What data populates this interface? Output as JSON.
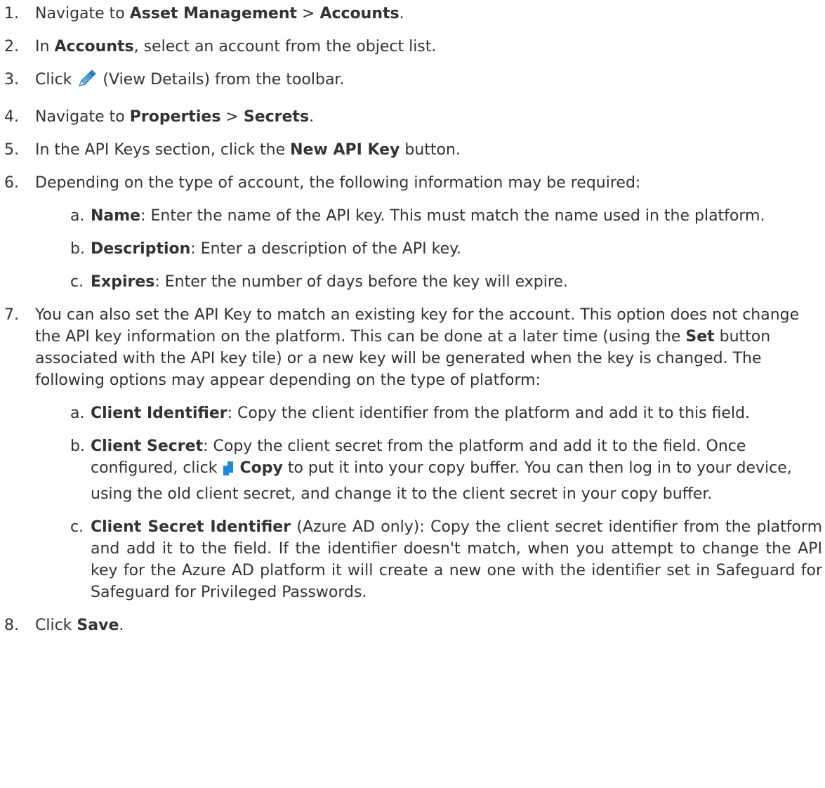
{
  "steps": [
    {
      "num": "1.",
      "t1": "Navigate to ",
      "b1": "Asset Management",
      "t2": " > ",
      "b2": "Accounts",
      "t3": "."
    },
    {
      "num": "2.",
      "t1": "In ",
      "b1": "Accounts",
      "t2": ", select an account from the object list."
    },
    {
      "num": "3.",
      "t1": "Click ",
      "icon": "pencil-icon",
      "t2": " (View Details) from the toolbar."
    },
    {
      "num": "4.",
      "t1": "Navigate to ",
      "b1": "Properties",
      "t2": " > ",
      "b2": "Secrets",
      "t3": "."
    },
    {
      "num": "5.",
      "t1": "In the API Keys section, click the ",
      "b1": "New API Key",
      "t2": " button."
    },
    {
      "num": "6.",
      "t1": "Depending on the type of account, the following information may be required:",
      "subs": [
        {
          "num": "a.",
          "b1": "Name",
          "t1": ": Enter the name of the API key. This must match the name used in the platform."
        },
        {
          "num": "b.",
          "b1": "Description",
          "t1": ": Enter a description of the API key."
        },
        {
          "num": "c.",
          "b1": "Expires",
          "t1": ": Enter the number of days before the key will expire."
        }
      ]
    },
    {
      "num": "7.",
      "t1": "You can also set the API Key to match an existing key for the account. This option does not change the API key information on the platform. This can be done at a later time (using the ",
      "b1": "Set",
      "t2": " button associated with the API key tile) or a new key will be generated when the key is changed. The following options may appear depending on the type of platform:",
      "subs": [
        {
          "num": "a.",
          "b1": "Client Identifier",
          "t1": ": Copy the client identifier from the platform and add it to this field."
        },
        {
          "num": "b.",
          "b1": "Client Secret",
          "t1": ": Copy the client secret from the platform and add it to the field. Once configured, click ",
          "icon": "copy-icon",
          "b2": "Copy",
          "t2": " to put it into your copy buffer. You can then log in to your device, using the old client secret, and change it to the client secret in your copy buffer."
        },
        {
          "num": "c.",
          "b1": "Client Secret Identifier",
          "t1": " (Azure AD only): Copy the client secret identifier from the platform and add it to the field. If the identifier doesn't match, when you attempt to change the API key for the Azure AD platform it will create a new one with the identifier set in Safeguard for Safeguard for Privileged Passwords."
        }
      ]
    },
    {
      "num": "8.",
      "t1": "Click ",
      "b1": "Save",
      "t2": "."
    }
  ],
  "colors": {
    "text": "#333333",
    "pencil_icon": "#2a8fd6",
    "copy_icon": "#1e88d8"
  }
}
